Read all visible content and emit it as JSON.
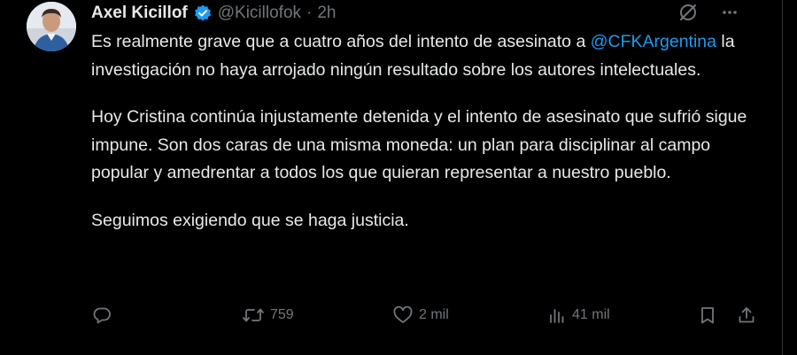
{
  "author": {
    "name": "Axel Kicillof",
    "handle": "@Kicillofok",
    "separator": "·",
    "time": "2h"
  },
  "tweet": {
    "p1_before": "Es realmente grave que a cuatro años del intento de asesinato a ",
    "p1_mention": "@CFKArgentina",
    "p1_after": " la investigación no haya arrojado ningún resultado sobre los autores intelectuales.",
    "p2": "Hoy Cristina continúa injustamente detenida y el intento de asesinato que sufrió sigue impune. Son dos caras de una misma moneda: un plan para disciplinar al campo popular y amedrentar a todos los que quieran representar a nuestro pueblo.",
    "p3": "Seguimos exigiendo que se haga justicia."
  },
  "actions": {
    "reply_count": "",
    "retweet_count": "759",
    "like_count": "2 mil",
    "views_count": "41 mil"
  },
  "colors": {
    "background": "#000000",
    "text": "#e7e9ea",
    "muted": "#71767b",
    "accent": "#1d9bf0"
  },
  "icons": {
    "verified": "verified-badge-icon",
    "grok": "grok-icon",
    "more": "more-icon",
    "reply": "reply-icon",
    "retweet": "retweet-icon",
    "like": "like-icon",
    "views": "views-icon",
    "bookmark": "bookmark-icon",
    "share": "share-icon"
  }
}
